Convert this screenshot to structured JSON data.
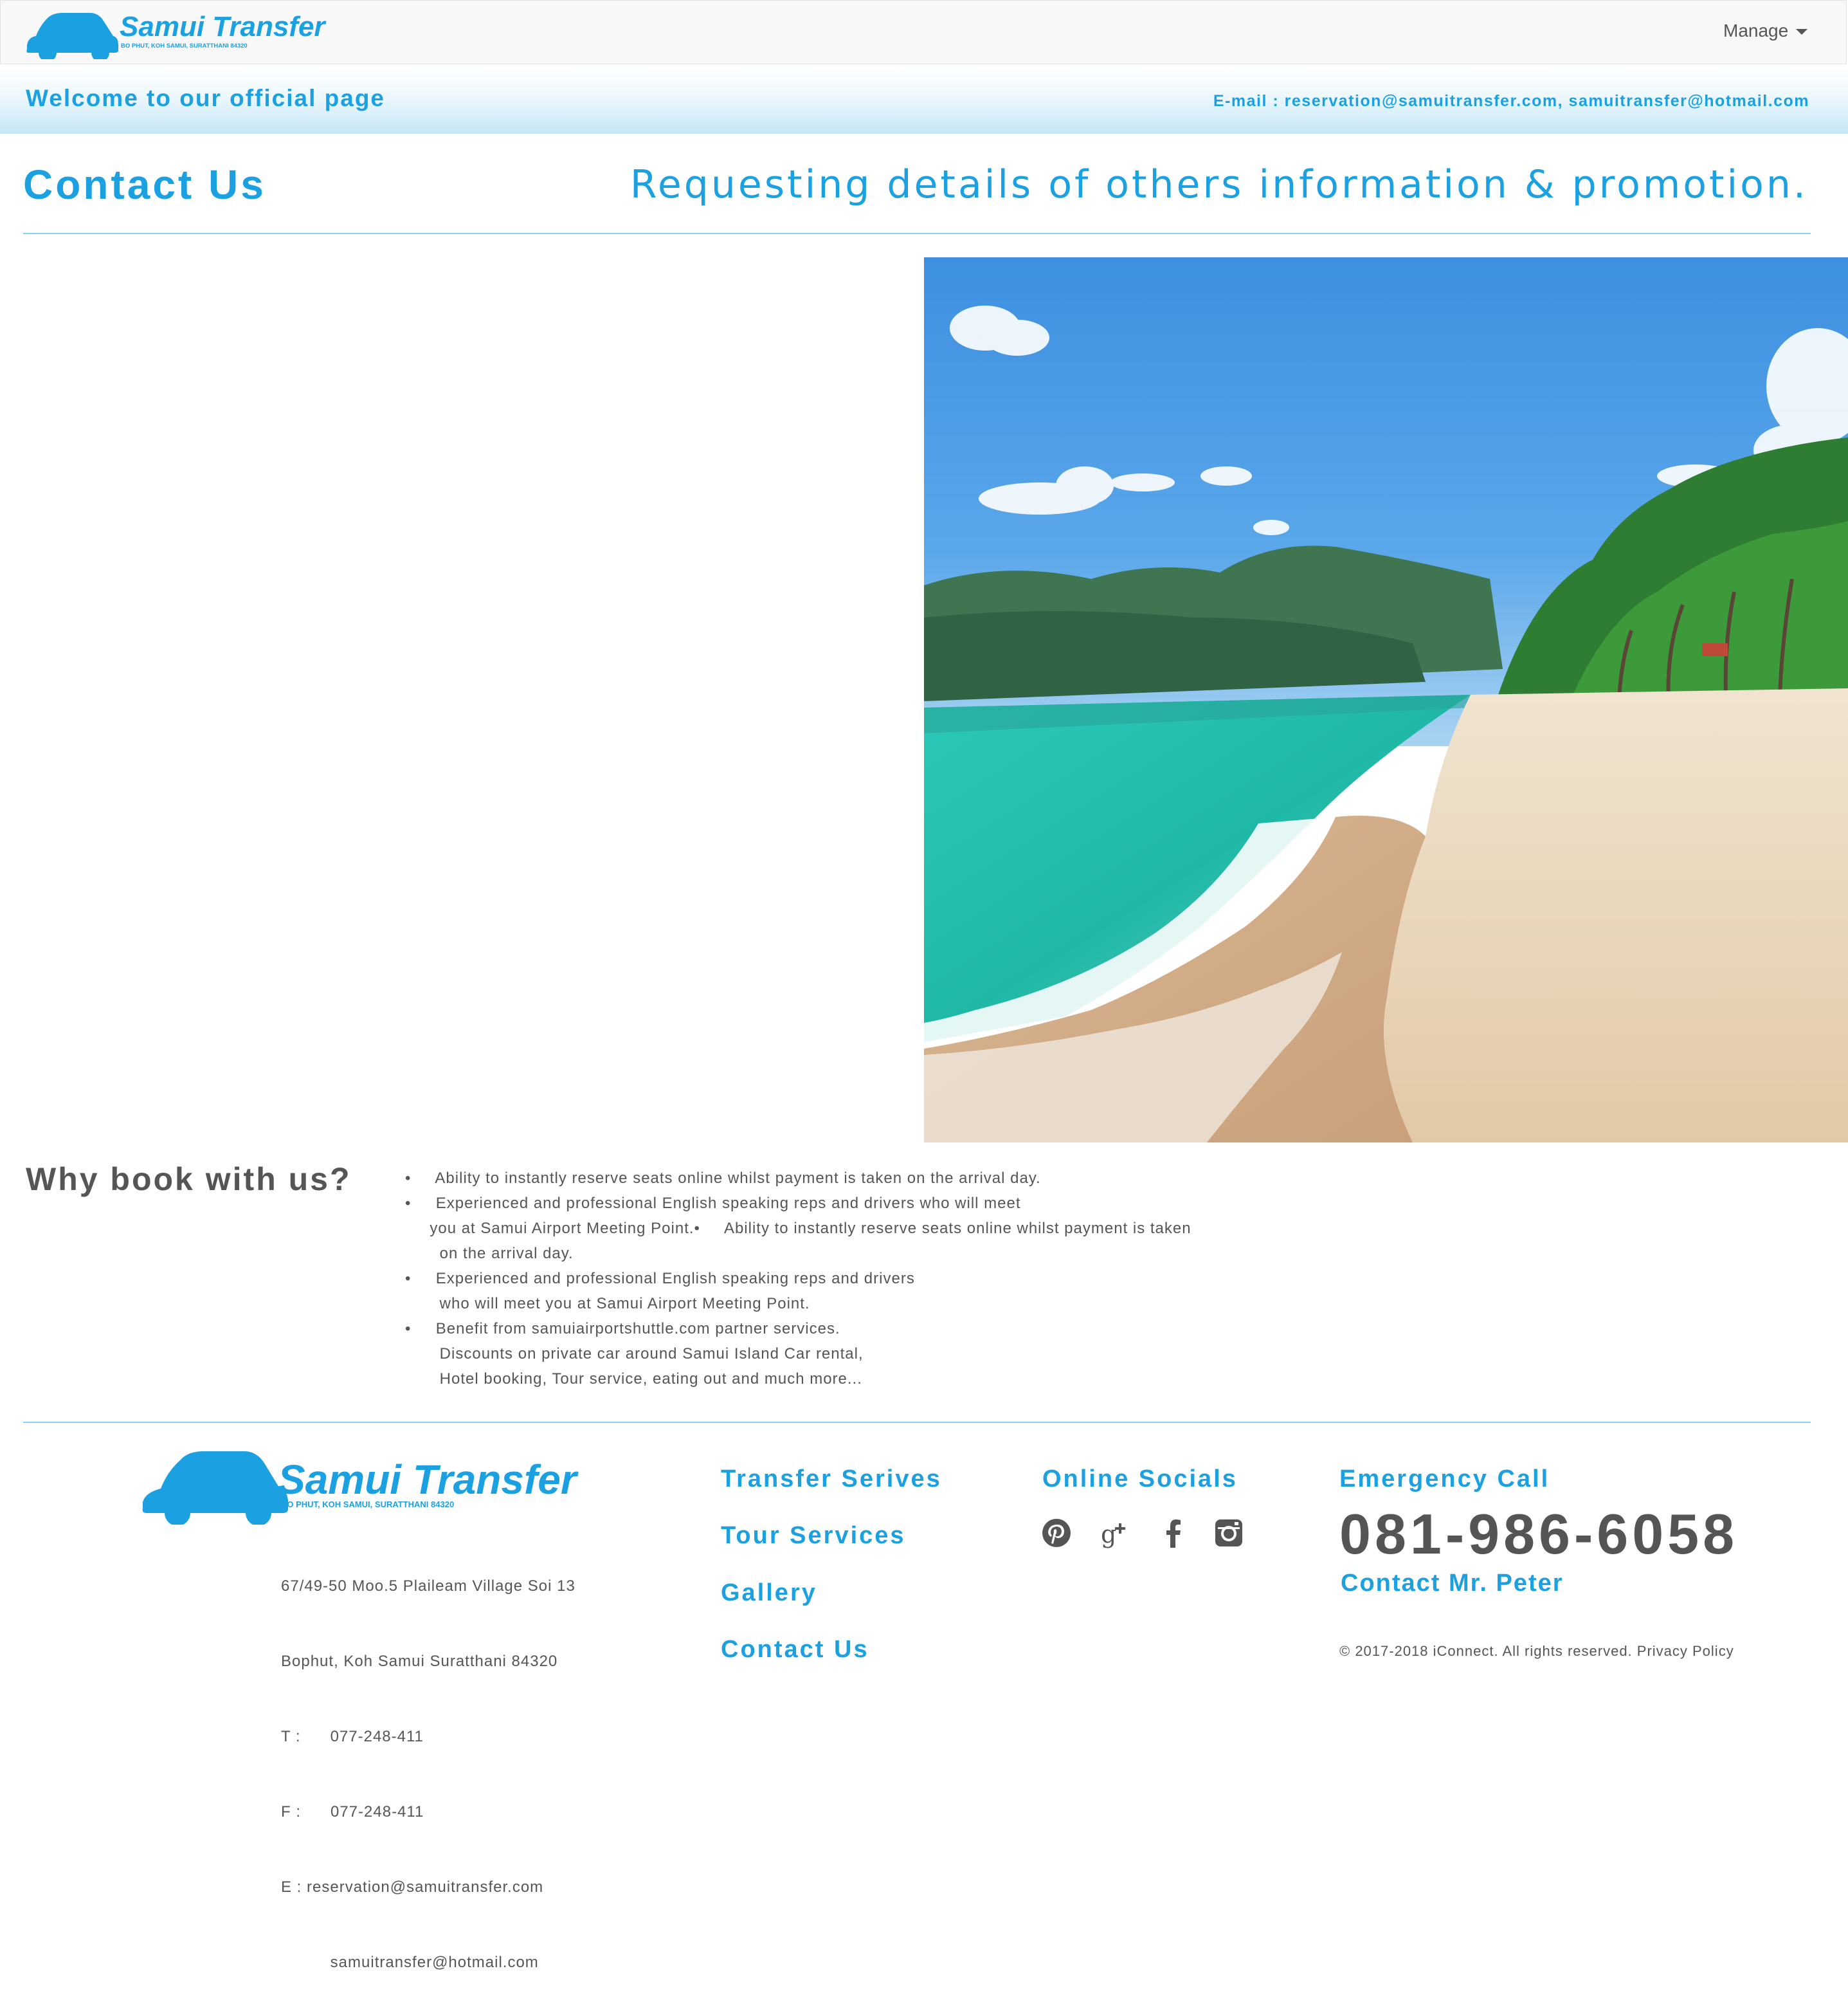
{
  "navbar": {
    "brand_name": "Samui Transfer",
    "brand_tagline": "BO PHUT, KOH SAMUI, SURATTHANI 84320",
    "manage_label": "Manage"
  },
  "welcome_bar": {
    "welcome_text": "Welcome to our official page",
    "email_text": "E-mail : reservation@samuitransfer.com, samuitransfer@hotmail.com"
  },
  "main": {
    "title": "Contact Us",
    "tagline": "Requesting details of  others information & promotion."
  },
  "why_book": {
    "title": "Why book with us?",
    "lines": [
      "•     Ability to instantly reserve seats online whilst payment is taken on the arrival day.",
      "•     Experienced and professional English speaking reps and drivers who will meet",
      "     you at Samui Airport Meeting Point.•     Ability to instantly reserve seats online whilst payment is taken",
      "       on the arrival day.",
      "•     Experienced and professional English speaking reps and drivers",
      "       who will meet you at Samui Airport Meeting Point.",
      "•     Benefit from samuiairportshuttle.com partner services.",
      "       Discounts on private car around Samui Island Car rental,",
      "       Hotel booking, Tour service, eating out and much more..."
    ]
  },
  "footer": {
    "brand_name": "Samui Transfer",
    "brand_tagline": "BO PHUT, KOH SAMUI, SURATTHANI 84320",
    "address_lines": [
      "67/49-50 Moo.5 Plaileam Village Soi 13",
      "Bophut, Koh Samui Suratthani 84320",
      "T :      077-248-411",
      "F :      077-248-411",
      "E : reservation@samuitransfer.com",
      "          samuitransfer@hotmail.com"
    ],
    "nav_links": [
      "Transfer Serives",
      "Tour Services",
      "Gallery",
      "Contact Us"
    ],
    "socials_title": "Online Socials",
    "social_icons": [
      "pinterest-icon",
      "google-plus-icon",
      "facebook-icon",
      "instagram-icon"
    ],
    "emergency_title": "Emergency Call",
    "phone": "081-986-6058",
    "contact_person": "Contact Mr. Peter",
    "copyright": "© 2017-2018 iConnect.  All rights reserved. Privacy Policy"
  },
  "colors": {
    "brand_blue": "#1ba1e2",
    "text_gray": "#555555",
    "rule_blue": "#8cd2f0"
  }
}
